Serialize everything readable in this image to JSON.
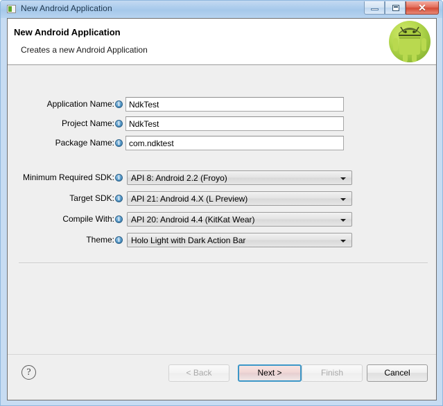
{
  "window": {
    "title": "New Android Application",
    "icon": "android-app-icon",
    "controls": {
      "minimize": "minimize-icon",
      "maximize": "maximize-icon",
      "close": "✕"
    }
  },
  "header": {
    "title": "New Android Application",
    "subtitle": "Creates a new Android Application",
    "logo": "android-robot-logo"
  },
  "form": {
    "text_fields": [
      {
        "label": "Application Name:",
        "value": "NdkTest",
        "info": "info-icon"
      },
      {
        "label": "Project Name:",
        "value": "NdkTest",
        "info": "info-icon"
      },
      {
        "label": "Package Name:",
        "value": "com.ndktest",
        "info": "info-icon"
      }
    ],
    "combos": [
      {
        "label": "Minimum Required SDK:",
        "value": "API 8: Android 2.2 (Froyo)",
        "info": "info-icon"
      },
      {
        "label": "Target SDK:",
        "value": "API 21: Android 4.X (L Preview)",
        "info": "info-icon"
      },
      {
        "label": "Compile With:",
        "value": "API 20: Android 4.4 (KitKat Wear)",
        "info": "info-icon"
      },
      {
        "label": "Theme:",
        "value": "Holo Light with Dark Action Bar",
        "info": "info-icon"
      }
    ]
  },
  "buttons": {
    "help": "?",
    "back": "< Back",
    "next": "Next >",
    "finish": "Finish",
    "cancel": "Cancel"
  },
  "colors": {
    "titlebar": "#a6c8ea",
    "dialog_bg": "#efefef",
    "close_button": "#d44c36",
    "focus_border": "#3c97c8",
    "info_icon": "#2e6f9e",
    "android_green": "#9ac43c"
  }
}
